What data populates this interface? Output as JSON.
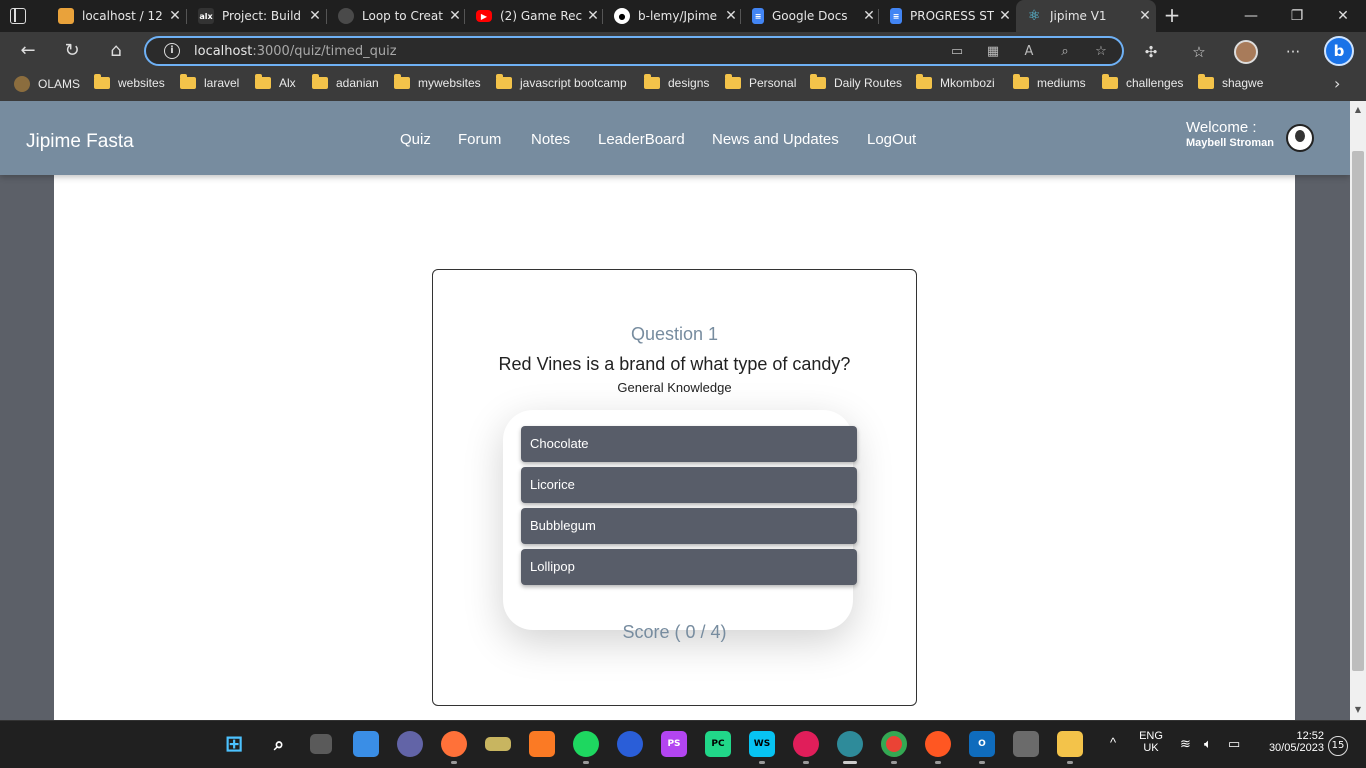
{
  "browser": {
    "tabs": [
      {
        "title": "localhost / 12",
        "icon": "phpmyadmin-icon",
        "color": "#e9a23b"
      },
      {
        "title": "Project: Build",
        "icon": "alx-icon",
        "color": "#333333"
      },
      {
        "title": "Loop to Creat",
        "icon": "openai-icon",
        "color": "#4a4a4a"
      },
      {
        "title": "(2) Game Rec",
        "icon": "youtube-icon",
        "color": "#ff0000"
      },
      {
        "title": "b-lemy/Jpime",
        "icon": "github-icon",
        "color": "#ffffff"
      },
      {
        "title": "Google Docs",
        "icon": "google-docs-icon",
        "color": "#4285f4"
      },
      {
        "title": "PROGRESS ST",
        "icon": "google-docs-icon",
        "color": "#4285f4"
      },
      {
        "title": "Jipime V1",
        "icon": "react-icon",
        "color": "#61dafb"
      }
    ],
    "url_host": "localhost",
    "url_rest": ":3000/quiz/timed_quiz",
    "bookmarks": [
      "OLAMS",
      "websites",
      "laravel",
      "Alx",
      "adanian",
      "mywebsites",
      "javascript bootcamp",
      "designs",
      "Personal",
      "Daily Routes",
      "Mkombozi",
      "mediums",
      "challenges",
      "shagwe"
    ]
  },
  "app": {
    "brand": "Jipime Fasta",
    "nav": [
      "Quiz",
      "Forum",
      "Notes",
      "LeaderBoard",
      "News and Updates",
      "LogOut"
    ],
    "welcome": "Welcome :",
    "username": "Maybell Stroman"
  },
  "quiz": {
    "question_number": "Question 1",
    "question": "Red Vines is a brand of what type of candy?",
    "category": "General Knowledge",
    "options": [
      "Chocolate",
      "Licorice",
      "Bubblegum",
      "Lollipop"
    ],
    "answer_text": "Licorice",
    "score": "Score ( 0 / 4)"
  },
  "taskbar": {
    "lang_top": "ENG",
    "lang_bottom": "UK",
    "time": "12:52",
    "date": "30/05/2023",
    "notifications": "15"
  }
}
